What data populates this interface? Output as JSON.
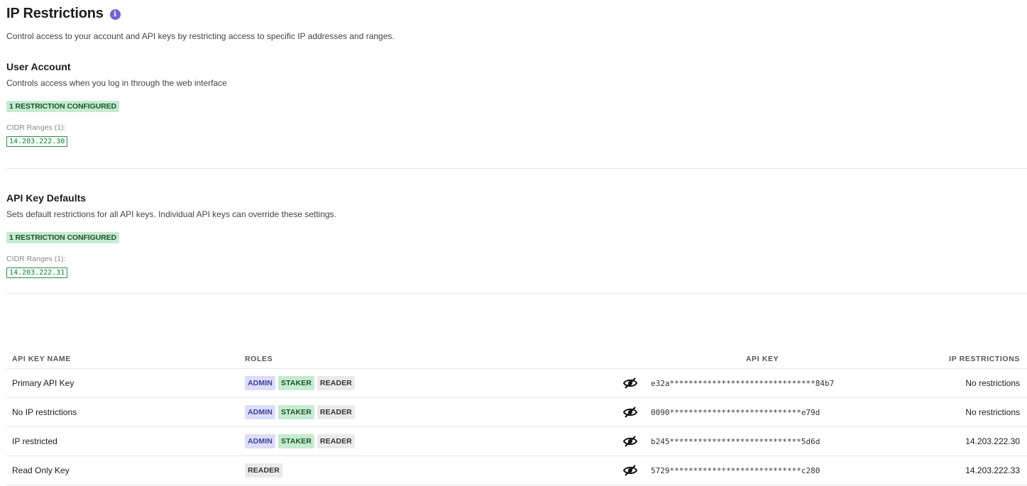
{
  "page": {
    "title": "IP Restrictions",
    "info_icon": "info-icon",
    "description": "Control access to your account and API keys by restricting access to specific IP addresses and ranges."
  },
  "user_account": {
    "title": "User Account",
    "description": "Controls access when you log in through the web interface",
    "badge": "1 RESTRICTION CONFIGURED",
    "cidr_label": "CIDR Ranges (1):",
    "cidr_values": [
      "14.203.222.30"
    ]
  },
  "api_key_defaults": {
    "title": "API Key Defaults",
    "description": "Sets default restrictions for all API keys. Individual API keys can override these settings.",
    "badge": "1 RESTRICTION CONFIGURED",
    "cidr_label": "CIDR Ranges (1):",
    "cidr_values": [
      "14.203.222.31"
    ]
  },
  "table": {
    "headers": {
      "name": "API KEY NAME",
      "roles": "ROLES",
      "key": "API KEY",
      "ip": "IP RESTRICTIONS"
    },
    "rows": [
      {
        "name": "Primary API Key",
        "roles": [
          "ADMIN",
          "STAKER",
          "READER"
        ],
        "key": "e32a*******************************84b7",
        "ip": "No restrictions",
        "eye_icon": "eye-slash-icon"
      },
      {
        "name": "No IP restrictions",
        "roles": [
          "ADMIN",
          "STAKER",
          "READER"
        ],
        "key": "0090****************************e79d",
        "ip": "No restrictions",
        "eye_icon": "eye-slash-icon"
      },
      {
        "name": "IP restricted",
        "roles": [
          "ADMIN",
          "STAKER",
          "READER"
        ],
        "key": "b245****************************5d6d",
        "ip": "14.203.222.30",
        "eye_icon": "eye-slash-icon"
      },
      {
        "name": "Read Only Key",
        "roles": [
          "READER"
        ],
        "key": "5729****************************c280",
        "ip": "14.203.222.33",
        "eye_icon": "eye-slash-icon"
      }
    ]
  },
  "colors": {
    "accent_info": "#6f63d9",
    "badge_green_bg": "#c5ecd0",
    "admin_bg": "#dcdef8",
    "reader_bg": "#eaeaea",
    "cidr_green": "#1d7a3a"
  }
}
